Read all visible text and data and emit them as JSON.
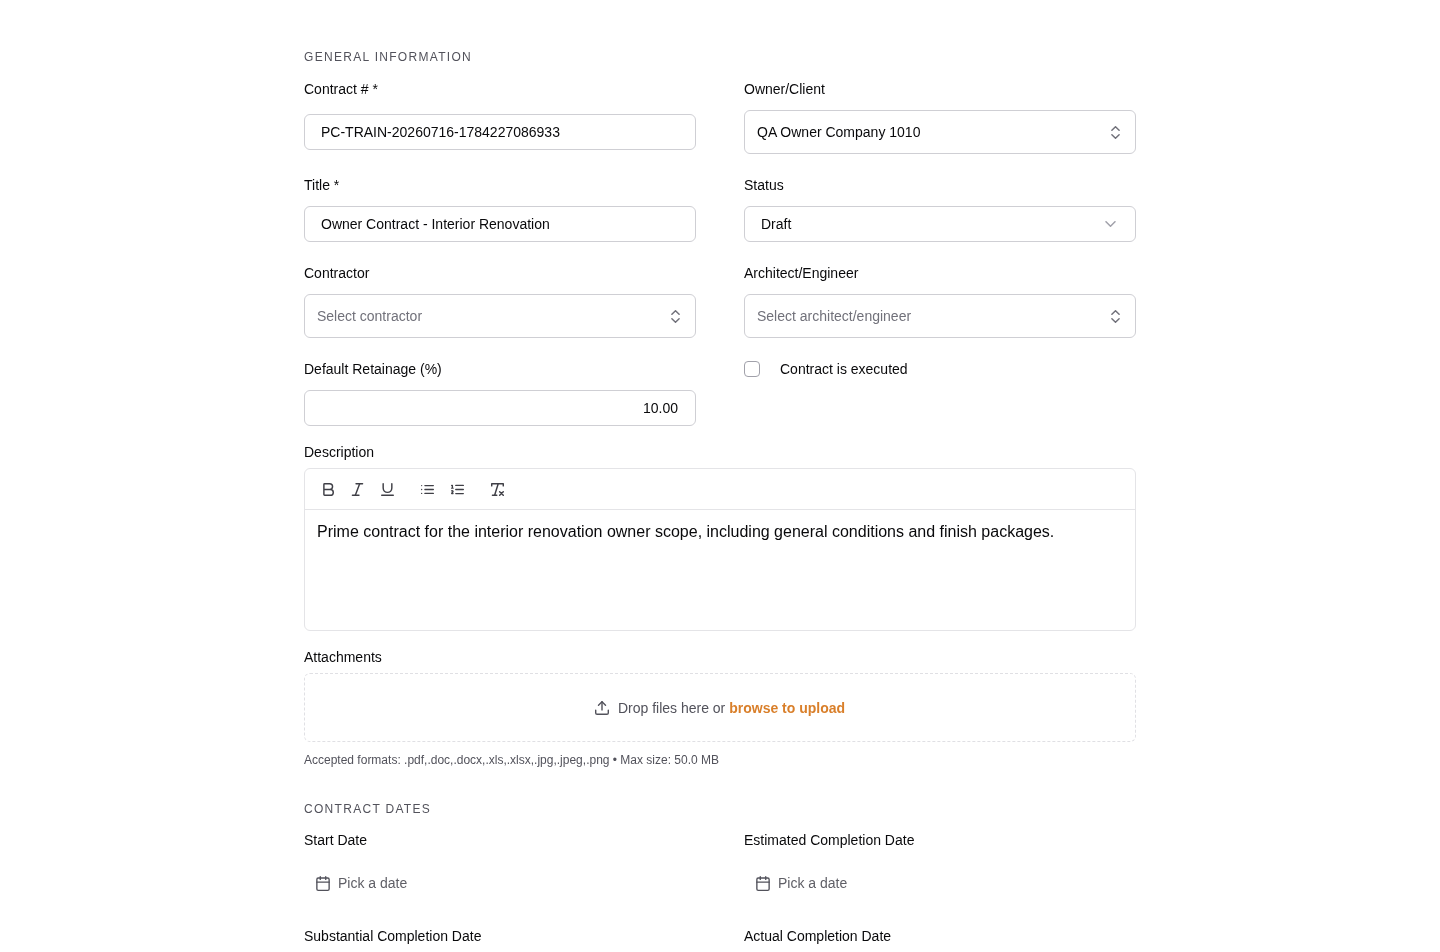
{
  "general_information": {
    "heading": "GENERAL INFORMATION",
    "fields": [
      {
        "kind": "text",
        "label": "Contract # *",
        "value": "PC-TRAIN-20260716-1784227086933"
      },
      {
        "kind": "combobox",
        "label": "Owner/Client",
        "value": "QA Owner Company 1010"
      },
      {
        "kind": "text",
        "label": "Title *",
        "value": "Owner Contract - Interior Renovation"
      },
      {
        "kind": "select",
        "label": "Status",
        "value": "Draft"
      },
      {
        "kind": "combobox",
        "label": "Contractor",
        "placeholder": "Select contractor"
      },
      {
        "kind": "combobox",
        "label": "Architect/Engineer",
        "placeholder": "Select architect/engineer"
      },
      {
        "kind": "number",
        "label": "Default Retainage (%)",
        "value": "10.00"
      },
      {
        "kind": "checkbox",
        "label": "Contract is executed",
        "checked": false
      }
    ]
  },
  "description": {
    "label": "Description",
    "value": "Prime contract for the interior renovation owner scope, including general conditions and finish packages."
  },
  "attachments": {
    "label": "Attachments",
    "prompt": "Drop files here or",
    "link": "browse to upload",
    "hint": "Accepted formats: .pdf,.doc,.docx,.xls,.xlsx,.jpg,.jpeg,.png • Max size: 50.0 MB"
  },
  "contract_dates": {
    "heading": "CONTRACT DATES",
    "fields": [
      {
        "label": "Start Date",
        "placeholder": "Pick a date"
      },
      {
        "label": "Estimated Completion Date",
        "placeholder": "Pick a date"
      },
      {
        "label": "Substantial Completion Date"
      },
      {
        "label": "Actual Completion Date"
      }
    ]
  }
}
